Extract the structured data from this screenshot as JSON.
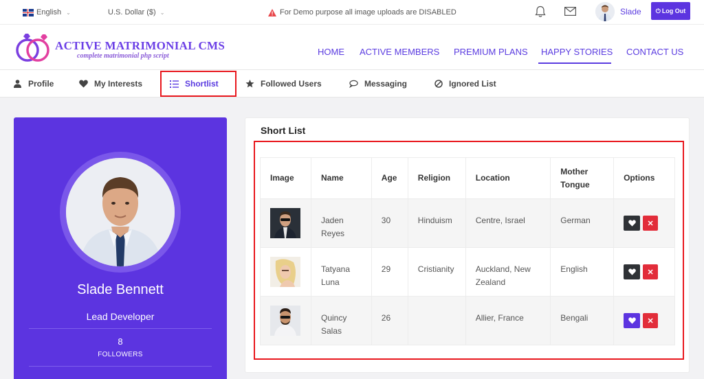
{
  "topbar": {
    "language": "English",
    "currency": "U.S. Dollar ($)",
    "demo_note": "For Demo purpose all image uploads are DISABLED",
    "user_name": "Slade",
    "logout_label": "Log Out"
  },
  "brand": {
    "title": "ACTIVE MATRIMONIAL CMS",
    "subtitle": "complete matrimonial php script"
  },
  "nav": {
    "items": [
      "HOME",
      "ACTIVE MEMBERS",
      "PREMIUM PLANS",
      "HAPPY STORIES",
      "CONTACT US"
    ],
    "active": "HAPPY STORIES"
  },
  "tabs": [
    "Profile",
    "My Interests",
    "Shortlist",
    "Followed Users",
    "Messaging",
    "Ignored List"
  ],
  "active_tab": "Shortlist",
  "profile": {
    "name": "Slade Bennett",
    "role": "Lead Developer",
    "followers_count": "8",
    "followers_label": "FOLLOWERS"
  },
  "shortlist": {
    "title": "Short List",
    "columns": [
      "Image",
      "Name",
      "Age",
      "Religion",
      "Location",
      "Mother Tongue",
      "Options"
    ],
    "rows": [
      {
        "name": "Jaden Reyes",
        "age": "30",
        "religion": "Hinduism",
        "location": "Centre, Israel",
        "tongue": "German",
        "heart_style": "dark"
      },
      {
        "name": "Tatyana Luna",
        "age": "29",
        "religion": "Cristianity",
        "location": "Auckland, New Zealand",
        "tongue": "English",
        "heart_style": "dark"
      },
      {
        "name": "Quincy Salas",
        "age": "26",
        "religion": "",
        "location": "Allier, France",
        "tongue": "Bengali",
        "heart_style": "purple"
      }
    ]
  },
  "colors": {
    "accent": "#5c34e0",
    "danger": "#e22d3a",
    "highlight": "#e8161c"
  }
}
